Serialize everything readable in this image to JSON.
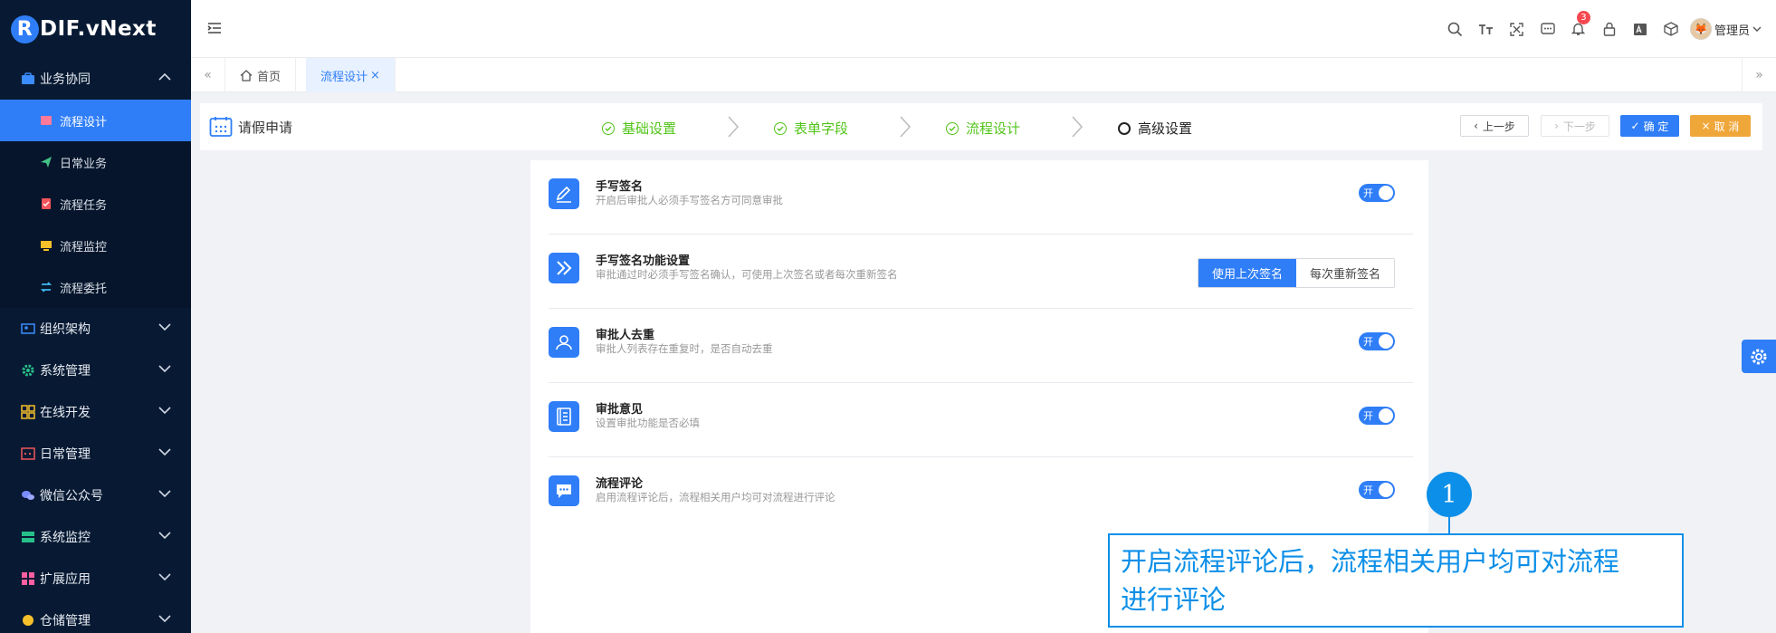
{
  "app": {
    "logo_letter": "R",
    "logo_text": "RDIF.vNext"
  },
  "sidebar": {
    "groups": [
      {
        "label": "业务协同",
        "expanded": true
      },
      {
        "label": "组织架构"
      },
      {
        "label": "系统管理"
      },
      {
        "label": "在线开发"
      },
      {
        "label": "日常管理"
      },
      {
        "label": "微信公众号"
      },
      {
        "label": "系统监控"
      },
      {
        "label": "扩展应用"
      },
      {
        "label": "仓储管理"
      }
    ],
    "sub_items": [
      {
        "label": "流程设计",
        "active": true
      },
      {
        "label": "日常业务"
      },
      {
        "label": "流程任务"
      },
      {
        "label": "流程监控"
      },
      {
        "label": "流程委托"
      }
    ]
  },
  "header": {
    "notification_count": "3",
    "user_name": "管理员"
  },
  "tabs": {
    "home": "首页",
    "active": "流程设计",
    "close_symbol": "×"
  },
  "toolbar": {
    "form_title": "请假申请",
    "steps": [
      {
        "label": "基础设置",
        "status": "done"
      },
      {
        "label": "表单字段",
        "status": "done"
      },
      {
        "label": "流程设计",
        "status": "done"
      },
      {
        "label": "高级设置",
        "status": "current"
      }
    ],
    "prev_label": "上一步",
    "next_label": "下一步",
    "confirm_label": "确 定",
    "cancel_label": "取 消"
  },
  "settings": [
    {
      "title": "手写签名",
      "desc": "开启后审批人必须手写签名方可同意审批",
      "control": "switch",
      "value": "开"
    },
    {
      "title": "手写签名功能设置",
      "desc": "审批通过时必须手写签名确认，可使用上次签名或者每次重新签名",
      "control": "segmented",
      "options": [
        "使用上次签名",
        "每次重新签名"
      ],
      "selected": "使用上次签名"
    },
    {
      "title": "审批人去重",
      "desc": "审批人列表存在重复时，是否自动去重",
      "control": "switch",
      "value": "开"
    },
    {
      "title": "审批意见",
      "desc": "设置审批功能是否必填",
      "control": "switch",
      "value": "开"
    },
    {
      "title": "流程评论",
      "desc": "启用流程评论后，流程相关用户均可对流程进行评论",
      "control": "switch",
      "value": "开"
    }
  ],
  "callout": {
    "number": "1",
    "line1": "开启流程评论后，流程相关用户均可对流程",
    "line2": "进行评论"
  },
  "colors": {
    "primary": "#2f7ef7",
    "sidebar_bg": "#081a33",
    "success": "#52c41a",
    "warning": "#f0a73a",
    "callout": "#0c8fe8"
  }
}
